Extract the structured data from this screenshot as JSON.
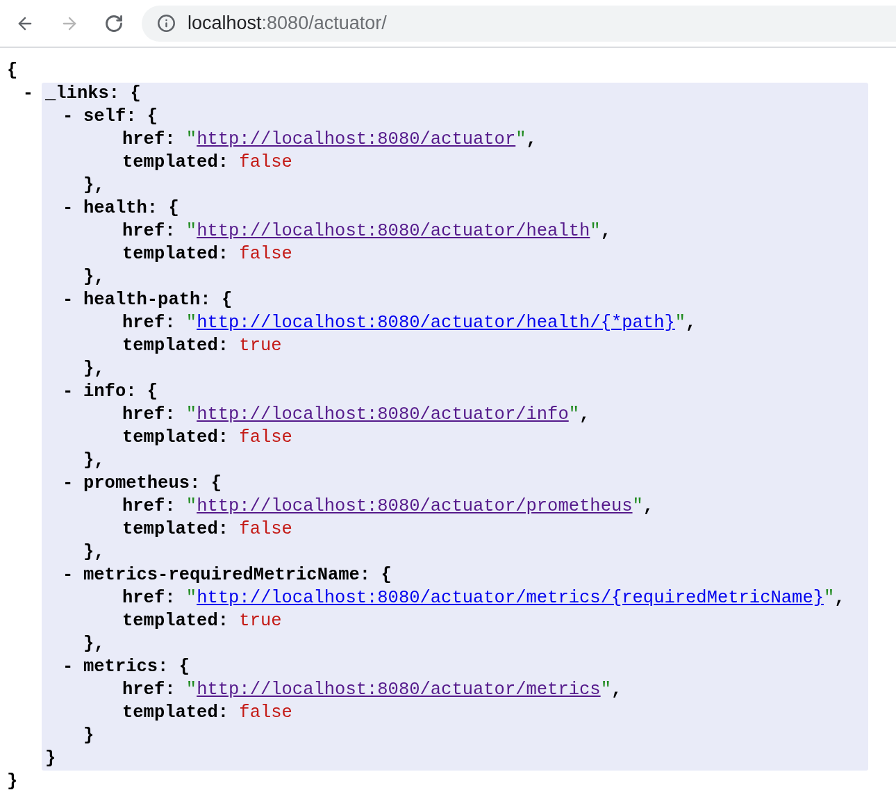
{
  "toolbar": {
    "back": {
      "disabled": false
    },
    "forward": {
      "disabled": true
    },
    "address": {
      "host": "localhost",
      "rest": ":8080/actuator/"
    }
  },
  "document": {
    "open": "{",
    "close": "}",
    "links": {
      "toggle": "-",
      "expanded": true,
      "key": "_links:",
      "open": "{",
      "close": "}",
      "entries": [
        {
          "toggle": "-",
          "expanded": true,
          "key": "self:",
          "open": "{",
          "href": {
            "key": "href:",
            "quote_open": "\"",
            "url": "http://localhost:8080/actuator",
            "visited": true,
            "quote_close": "\"",
            "comma": ","
          },
          "templated": {
            "key": "templated:",
            "value": "false"
          },
          "close": "},"
        },
        {
          "toggle": "-",
          "expanded": true,
          "key": "health:",
          "open": "{",
          "href": {
            "key": "href:",
            "quote_open": "\"",
            "url": "http://localhost:8080/actuator/health",
            "visited": true,
            "quote_close": "\"",
            "comma": ","
          },
          "templated": {
            "key": "templated:",
            "value": "false"
          },
          "close": "},"
        },
        {
          "toggle": "-",
          "expanded": true,
          "key": "health-path:",
          "open": "{",
          "href": {
            "key": "href:",
            "quote_open": "\"",
            "url": "http://localhost:8080/actuator/health/{*path}",
            "visited": false,
            "quote_close": "\"",
            "comma": ","
          },
          "templated": {
            "key": "templated:",
            "value": "true"
          },
          "close": "},"
        },
        {
          "toggle": "-",
          "expanded": true,
          "key": "info:",
          "open": "{",
          "href": {
            "key": "href:",
            "quote_open": "\"",
            "url": "http://localhost:8080/actuator/info",
            "visited": true,
            "quote_close": "\"",
            "comma": ","
          },
          "templated": {
            "key": "templated:",
            "value": "false"
          },
          "close": "},"
        },
        {
          "toggle": "-",
          "expanded": true,
          "key": "prometheus:",
          "open": "{",
          "href": {
            "key": "href:",
            "quote_open": "\"",
            "url": "http://localhost:8080/actuator/prometheus",
            "visited": true,
            "quote_close": "\"",
            "comma": ","
          },
          "templated": {
            "key": "templated:",
            "value": "false"
          },
          "close": "},"
        },
        {
          "toggle": "-",
          "expanded": true,
          "key": "metrics-requiredMetricName:",
          "open": "{",
          "href": {
            "key": "href:",
            "quote_open": "\"",
            "url": "http://localhost:8080/actuator/metrics/{requiredMetricName}",
            "visited": false,
            "quote_close": "\"",
            "comma": ","
          },
          "templated": {
            "key": "templated:",
            "value": "true"
          },
          "close": "},"
        },
        {
          "toggle": "-",
          "expanded": true,
          "key": "metrics:",
          "open": "{",
          "href": {
            "key": "href:",
            "quote_open": "\"",
            "url": "http://localhost:8080/actuator/metrics",
            "visited": true,
            "quote_close": "\"",
            "comma": ","
          },
          "templated": {
            "key": "templated:",
            "value": "false"
          },
          "close": "}"
        }
      ]
    }
  }
}
